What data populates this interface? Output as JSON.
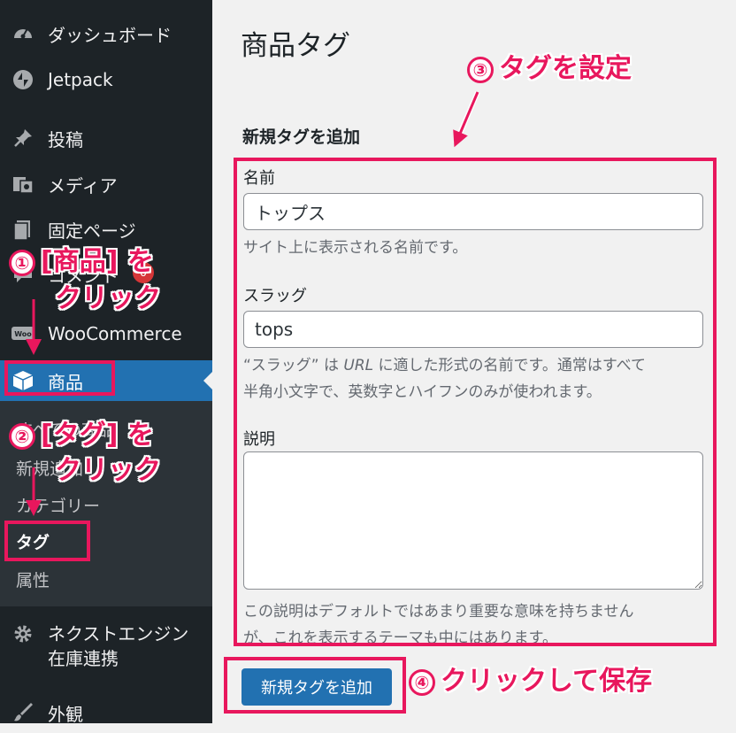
{
  "sidebar": {
    "items": [
      {
        "label": "ダッシュボード",
        "icon": "dashboard-icon"
      },
      {
        "label": "Jetpack",
        "icon": "jetpack-icon"
      },
      {
        "label": "投稿",
        "icon": "pin-icon"
      },
      {
        "label": "メディア",
        "icon": "media-icon"
      },
      {
        "label": "固定ページ",
        "icon": "page-icon"
      },
      {
        "label": "コメント",
        "icon": "comment-icon"
      },
      {
        "label": "WooCommerce",
        "icon": "woocommerce-icon"
      },
      {
        "label": "商品",
        "icon": "box-icon"
      },
      {
        "label": "ネクストエンジン",
        "icon": "gear-icon"
      },
      {
        "label": "在庫連携",
        "icon": ""
      },
      {
        "label": "外観",
        "icon": "paintbrush-icon"
      }
    ],
    "comment_badge": "0",
    "submenu": [
      "すべての商品",
      "新規追加",
      "カテゴリー",
      "タグ",
      "属性"
    ]
  },
  "main": {
    "title": "商品タグ",
    "section_title": "新規タグを追加",
    "name_label": "名前",
    "name_value": "トップス",
    "name_help": "サイト上に表示される名前です。",
    "slug_label": "スラッグ",
    "slug_value": "tops",
    "slug_help_1a": "“スラッグ” は ",
    "slug_help_1b": "URL",
    "slug_help_1c": " に適した形式の名前です。通常はすべて",
    "slug_help_2": "半角小文字で、英数字とハイフンのみが使われます。",
    "desc_label": "説明",
    "desc_help_1": "この説明はデフォルトではあまり重要な意味を持ちません",
    "desc_help_2": "が、これを表示するテーマも中にはあります。",
    "submit_label": "新規タグを追加"
  },
  "annotations": {
    "step1_num": "①",
    "step1_line1": "[商品] を",
    "step1_line2": "クリック",
    "step2_num": "②",
    "step2_line1": "[タグ] を",
    "step2_line2": "クリック",
    "step3_num": "③",
    "step3_text": "タグを設定",
    "step4_num": "④",
    "step4_text": "クリックして保存",
    "color": "#e8175d"
  },
  "colors": {
    "sidebar_bg": "#1d2327",
    "submenu_bg": "#2c3338",
    "accent": "#2271b1",
    "badge": "#d63638"
  }
}
